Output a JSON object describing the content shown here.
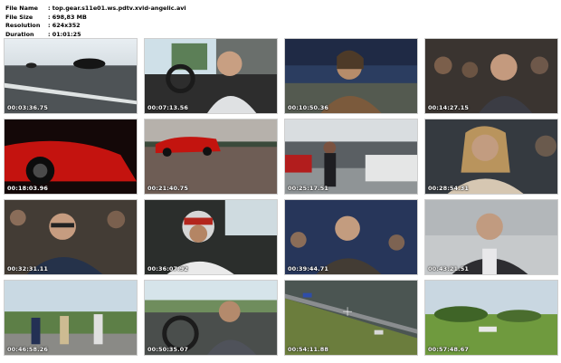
{
  "header": {
    "rows": [
      {
        "label": "File Name",
        "value": ": top.gear.s11e01.ws.pdtv.xvid-angelic.avi"
      },
      {
        "label": "File Size",
        "value": ": 698,83 MB"
      },
      {
        "label": "Resolution",
        "value": ": 624x352"
      },
      {
        "label": "Duration",
        "value": ": 01:01:25"
      }
    ]
  },
  "thumbnails": [
    {
      "timestamp": "00:03:36.75",
      "scene": "cars-on-test-track"
    },
    {
      "timestamp": "00:07:13.56",
      "scene": "presenter-driving-car"
    },
    {
      "timestamp": "00:10:50.36",
      "scene": "presenter-in-studio"
    },
    {
      "timestamp": "00:14:27.15",
      "scene": "presenter-with-audience"
    },
    {
      "timestamp": "00:18:03.96",
      "scene": "red-supercar-closeup"
    },
    {
      "timestamp": "00:21:40.75",
      "scene": "red-car-on-track"
    },
    {
      "timestamp": "00:25:17.51",
      "scene": "man-walking-in-car-lot"
    },
    {
      "timestamp": "00:28:54.31",
      "scene": "long-haired-presenter"
    },
    {
      "timestamp": "00:32:31.11",
      "scene": "presenter-with-glasses"
    },
    {
      "timestamp": "00:36:07.92",
      "scene": "driver-in-helmet"
    },
    {
      "timestamp": "00:39:44.71",
      "scene": "presenter-in-crowd"
    },
    {
      "timestamp": "00:43:21.51",
      "scene": "presenter-outdoors"
    },
    {
      "timestamp": "00:46:58.26",
      "scene": "presenters-on-airfield"
    },
    {
      "timestamp": "00:50:35.07",
      "scene": "presenter-at-wheel"
    },
    {
      "timestamp": "00:54:11.88",
      "scene": "aerial-track-view"
    },
    {
      "timestamp": "00:57:48.67",
      "scene": "green-field-landscape"
    }
  ]
}
